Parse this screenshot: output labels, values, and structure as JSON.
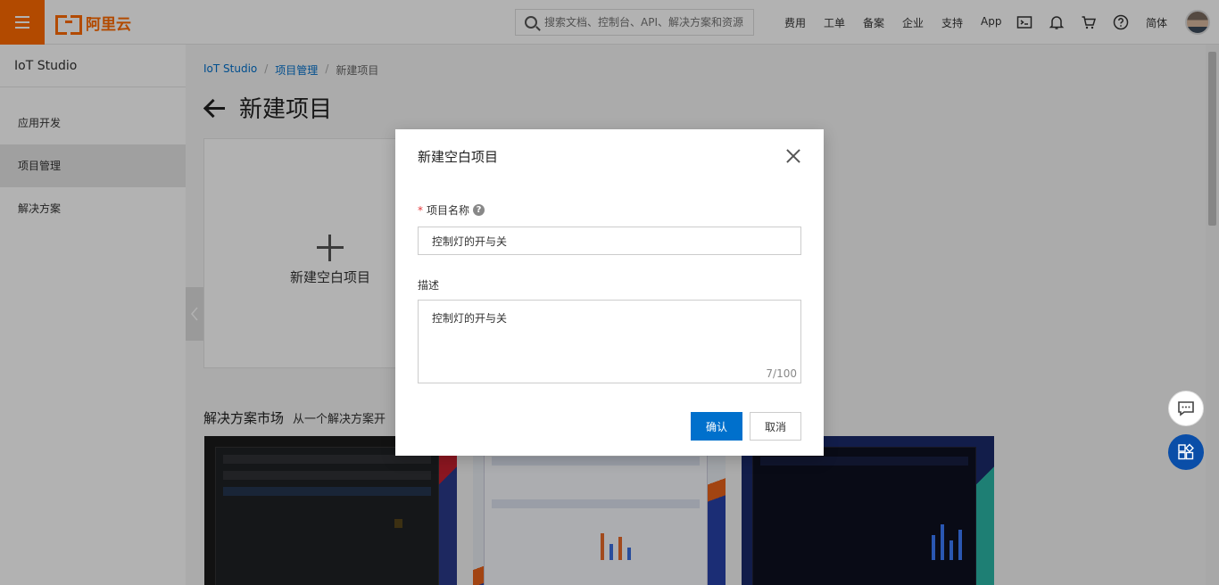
{
  "header": {
    "logo_text": "阿里云",
    "search_placeholder": "搜索文档、控制台、API、解决方案和资源",
    "nav": [
      "费用",
      "工单",
      "备案",
      "企业",
      "支持",
      "App"
    ],
    "lang": "简体",
    "icons": [
      "terminal-icon",
      "bell-icon",
      "cart-icon",
      "help-icon"
    ]
  },
  "sidebar": {
    "title": "IoT Studio",
    "items": [
      {
        "label": "应用开发",
        "active": false
      },
      {
        "label": "项目管理",
        "active": true
      },
      {
        "label": "解决方案",
        "active": false
      }
    ]
  },
  "breadcrumb": {
    "items": [
      "IoT Studio",
      "项目管理",
      "新建项目"
    ],
    "separator": "/"
  },
  "page": {
    "title": "新建项目",
    "new_card_label": "新建空白项目",
    "market_title": "解决方案市场",
    "market_subtitle": "从一个解决方案开"
  },
  "dialog": {
    "title": "新建空白项目",
    "name_label": "项目名称",
    "name_required": "*",
    "name_value": "控制灯的开与关",
    "desc_label": "描述",
    "desc_value": "控制灯的开与关",
    "counter": "7/100",
    "confirm_label": "确认",
    "cancel_label": "取消"
  },
  "colors": {
    "brand": "#ff6a00",
    "primary": "#0070cc",
    "float_apps": "#0a4ea8"
  }
}
